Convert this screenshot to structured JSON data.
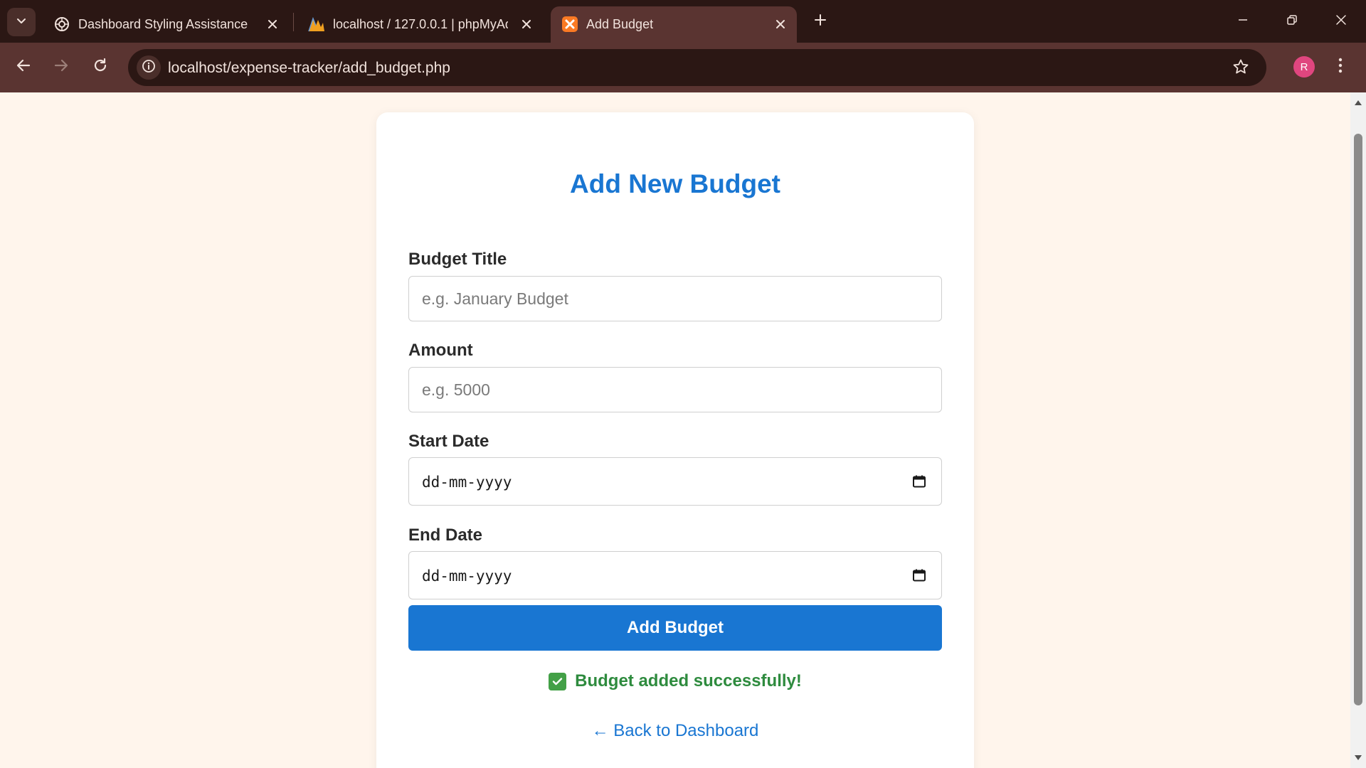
{
  "browser": {
    "tabs": [
      {
        "title": "Dashboard Styling Assistance",
        "favicon": "openai-icon",
        "active": false
      },
      {
        "title": "localhost / 127.0.0.1 | phpMyAd",
        "favicon": "phpmyadmin-icon",
        "active": false
      },
      {
        "title": "Add Budget",
        "favicon": "xampp-icon",
        "active": true
      }
    ],
    "url": "localhost/expense-tracker/add_budget.php",
    "profile_initial": "R"
  },
  "form": {
    "heading": "Add New Budget",
    "fields": [
      {
        "label": "Budget Title",
        "placeholder": "e.g. January Budget",
        "type": "text"
      },
      {
        "label": "Amount",
        "placeholder": "e.g. 5000",
        "type": "number"
      },
      {
        "label": "Start Date",
        "value": "dd-mm-yyyy",
        "type": "date"
      },
      {
        "label": "End Date",
        "value": "dd-mm-yyyy",
        "type": "date"
      }
    ],
    "submit_label": "Add Budget",
    "success_message": "Budget added successfully!",
    "back_link": "← Back to Dashboard"
  },
  "colors": {
    "accent": "#1976d2",
    "success": "#2e8b3e",
    "page_background": "#fff5ec",
    "chrome_dark": "#2b1714",
    "chrome_toolbar": "#5a3431"
  }
}
